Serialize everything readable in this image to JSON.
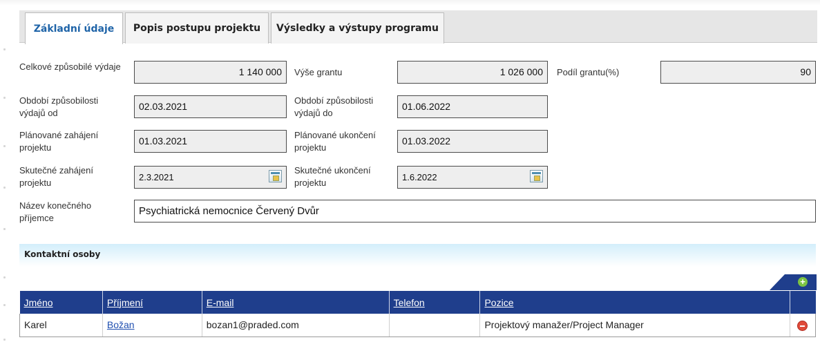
{
  "tabs": [
    {
      "label": "Základní údaje",
      "active": true
    },
    {
      "label": "Popis postupu projektu",
      "active": false
    },
    {
      "label": "Výsledky a výstupy programu",
      "active": false
    }
  ],
  "form": {
    "celkove": {
      "label": "Celkové způsobilé výdaje",
      "value": "1 140 000"
    },
    "vyse": {
      "label": "Výše grantu",
      "value": "1 026 000"
    },
    "podil": {
      "label": "Podíl grantu(%)",
      "value": "90"
    },
    "obdobi_od": {
      "label": "Období způsobilosti výdajů od",
      "value": "02.03.2021"
    },
    "obdobi_do": {
      "label": "Období způsobilosti výdajů do",
      "value": "01.06.2022"
    },
    "plan_zahajeni": {
      "label": "Plánované zahájení projektu",
      "value": "01.03.2021"
    },
    "plan_ukonceni": {
      "label": "Plánované ukončení projektu",
      "value": "01.03.2022"
    },
    "skut_zahajeni": {
      "label": "Skutečné zahájení projektu",
      "value": "2.3.2021"
    },
    "skut_ukonceni": {
      "label": "Skutečné ukončení projektu",
      "value": "1.6.2022"
    },
    "nazev": {
      "label": "Název konečného příjemce",
      "value": "Psychiatrická nemocnice Červený Dvůr"
    }
  },
  "contacts": {
    "title": "Kontaktní osoby",
    "columns": [
      "Jméno",
      "Příjmení",
      "E-mail",
      "Telefon",
      "Pozice"
    ],
    "rows": [
      {
        "jmeno": "Karel",
        "prijmeni": "Božan",
        "email": "bozan1@praded.com",
        "telefon": "",
        "pozice": "Projektový manažer/Project Manager"
      }
    ]
  },
  "icons": {
    "add": "add-icon",
    "delete": "delete-icon",
    "calendar": "calendar-icon"
  },
  "colors": {
    "header_blue": "#1f3e8c",
    "tab_active_text": "#1f64a8",
    "section_bg": "#d3eefb"
  }
}
